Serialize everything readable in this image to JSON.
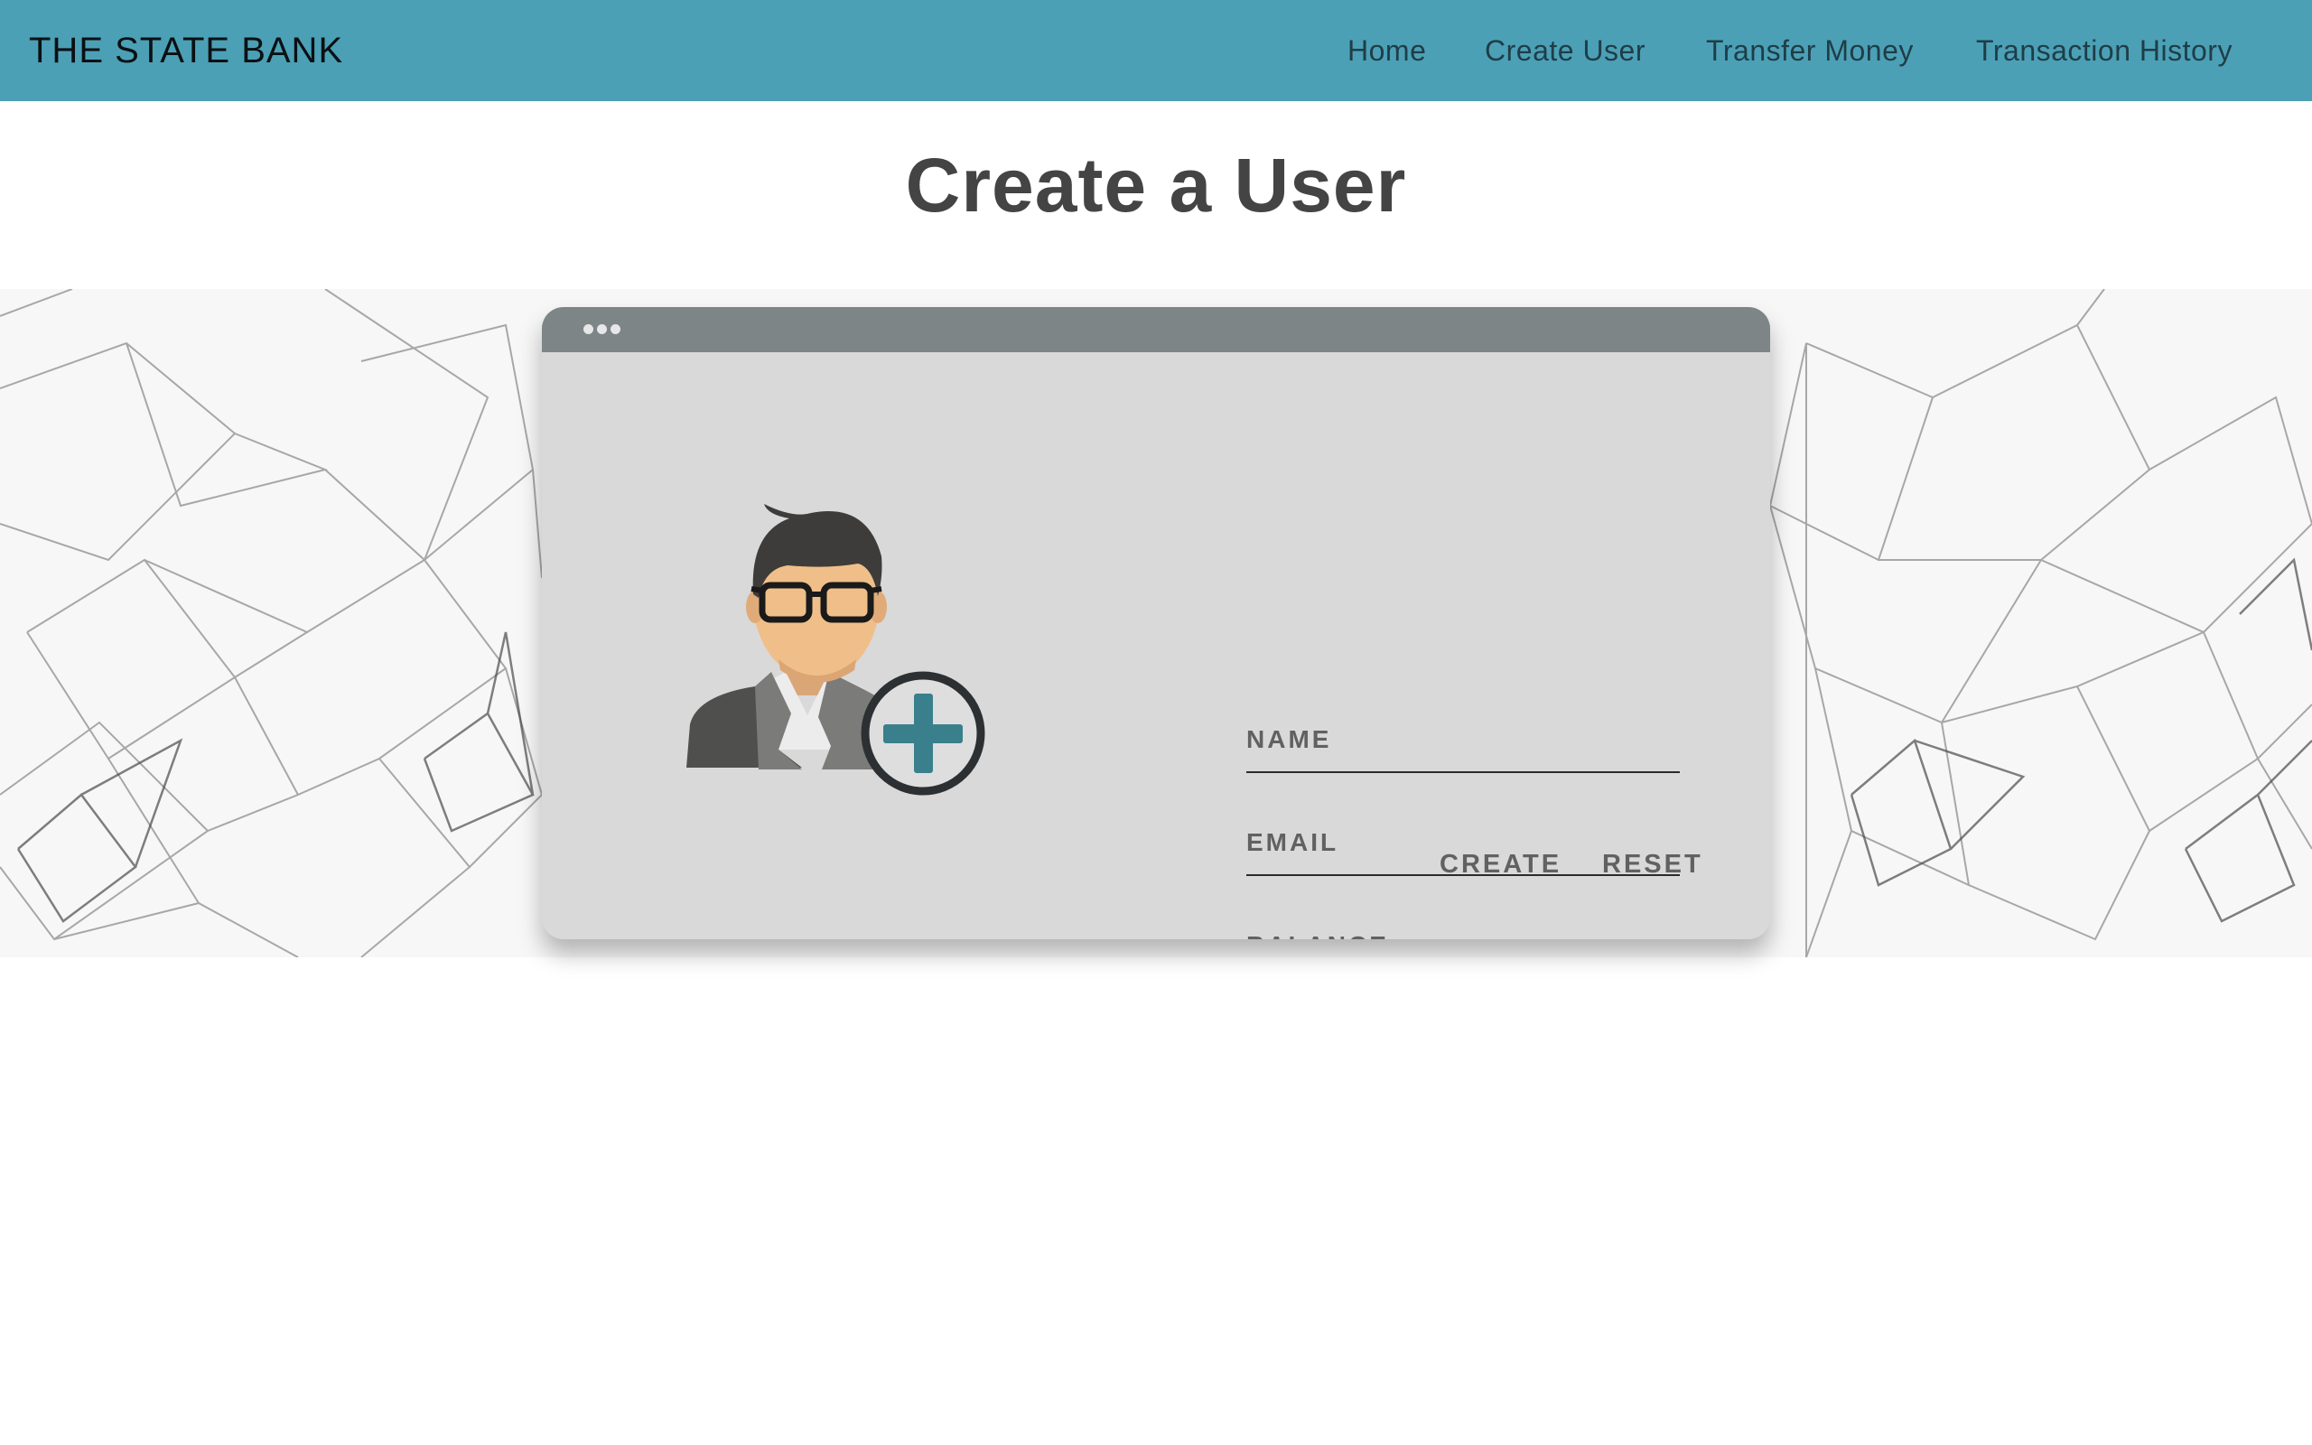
{
  "navbar": {
    "brand": "THE STATE BANK",
    "links": [
      "Home",
      "Create User",
      "Transfer Money",
      "Transaction History"
    ],
    "background_color": "#4ba0b6"
  },
  "page": {
    "title": "Create a User"
  },
  "card": {
    "illustration": "user-add-icon",
    "fields": {
      "name_placeholder": "NAME",
      "email_placeholder": "EMAIL",
      "balance_placeholder": "BALANCE"
    },
    "buttons": {
      "create_label": "CREATE",
      "reset_label": "RESET"
    },
    "accent_color": "#3a7f8c"
  }
}
